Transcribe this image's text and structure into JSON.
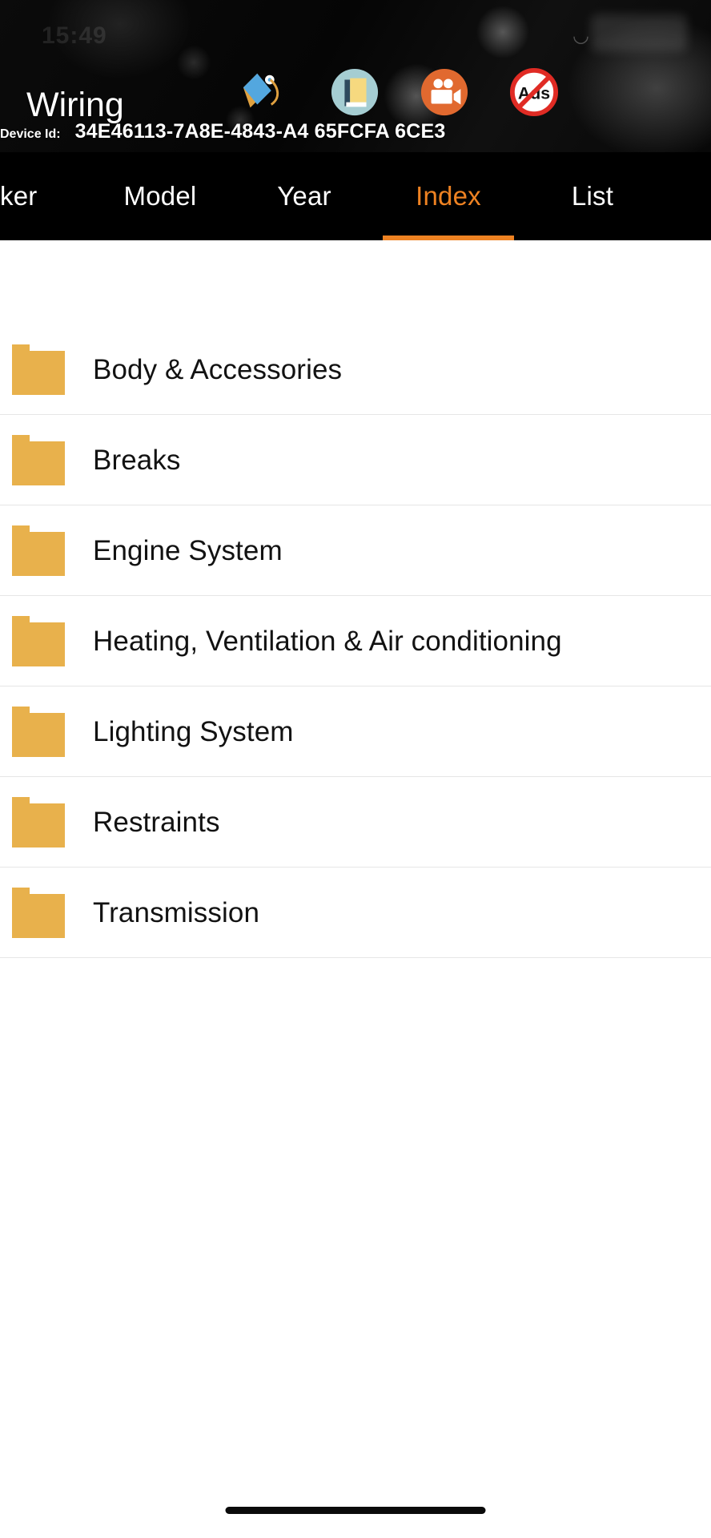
{
  "header": {
    "title": "Wiring",
    "device_id_label": "Device Id:",
    "device_id_value": "34E46113-7A8E-4843-A4  65FCFA  6CE3",
    "ghost_status_time": "15:49",
    "icons": [
      {
        "name": "price-tag-icon",
        "label": "Tags"
      },
      {
        "name": "book-icon",
        "label": "Book"
      },
      {
        "name": "video-camera-icon",
        "label": "Video"
      },
      {
        "name": "no-ads-icon",
        "label": "Ads"
      }
    ]
  },
  "tabs": [
    {
      "label": "ker",
      "active": false,
      "partial": true
    },
    {
      "label": "Model",
      "active": false,
      "partial": false
    },
    {
      "label": "Year",
      "active": false,
      "partial": false
    },
    {
      "label": "Index",
      "active": true,
      "partial": false
    },
    {
      "label": "List",
      "active": false,
      "partial": false
    }
  ],
  "list": {
    "items": [
      {
        "label": "Body & Accessories",
        "icon": "folder-icon"
      },
      {
        "label": "Breaks",
        "icon": "folder-icon"
      },
      {
        "label": "Engine System",
        "icon": "folder-icon"
      },
      {
        "label": "Heating, Ventilation & Air conditioning",
        "icon": "folder-icon"
      },
      {
        "label": "Lighting System",
        "icon": "folder-icon"
      },
      {
        "label": "Restraints",
        "icon": "folder-icon"
      },
      {
        "label": "Transmission",
        "icon": "folder-icon"
      }
    ]
  },
  "colors": {
    "accent_orange": "#ee8222",
    "folder_amber": "#e8b14c",
    "header_background": "#000000",
    "page_background": "#ffffff",
    "row_divider": "#e6e6e6",
    "text_primary": "#121212",
    "text_on_dark": "#ffffff"
  }
}
